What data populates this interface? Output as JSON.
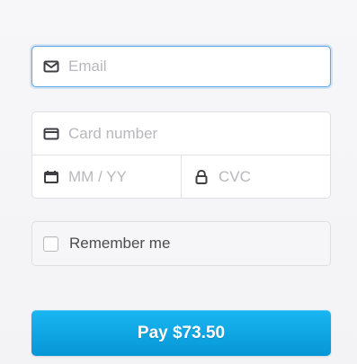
{
  "checkout": {
    "email": {
      "placeholder": "Email",
      "icon": "mail-icon"
    },
    "card": {
      "number_placeholder": "Card number",
      "number_icon": "credit-card-icon",
      "expiry_placeholder": "MM / YY",
      "expiry_icon": "calendar-icon",
      "cvc_placeholder": "CVC",
      "cvc_icon": "lock-icon"
    },
    "remember": {
      "label": "Remember me",
      "checked": false
    },
    "pay_button": {
      "label": "Pay $73.50"
    }
  },
  "colors": {
    "background": "#f5f5f7",
    "focus_border": "#5aa7e6",
    "field_border": "#dfdfe3",
    "placeholder_text": "#b8b8bc",
    "label_text": "#4b4b50",
    "button_top": "#19b7f2",
    "button_bottom": "#0696d6"
  }
}
